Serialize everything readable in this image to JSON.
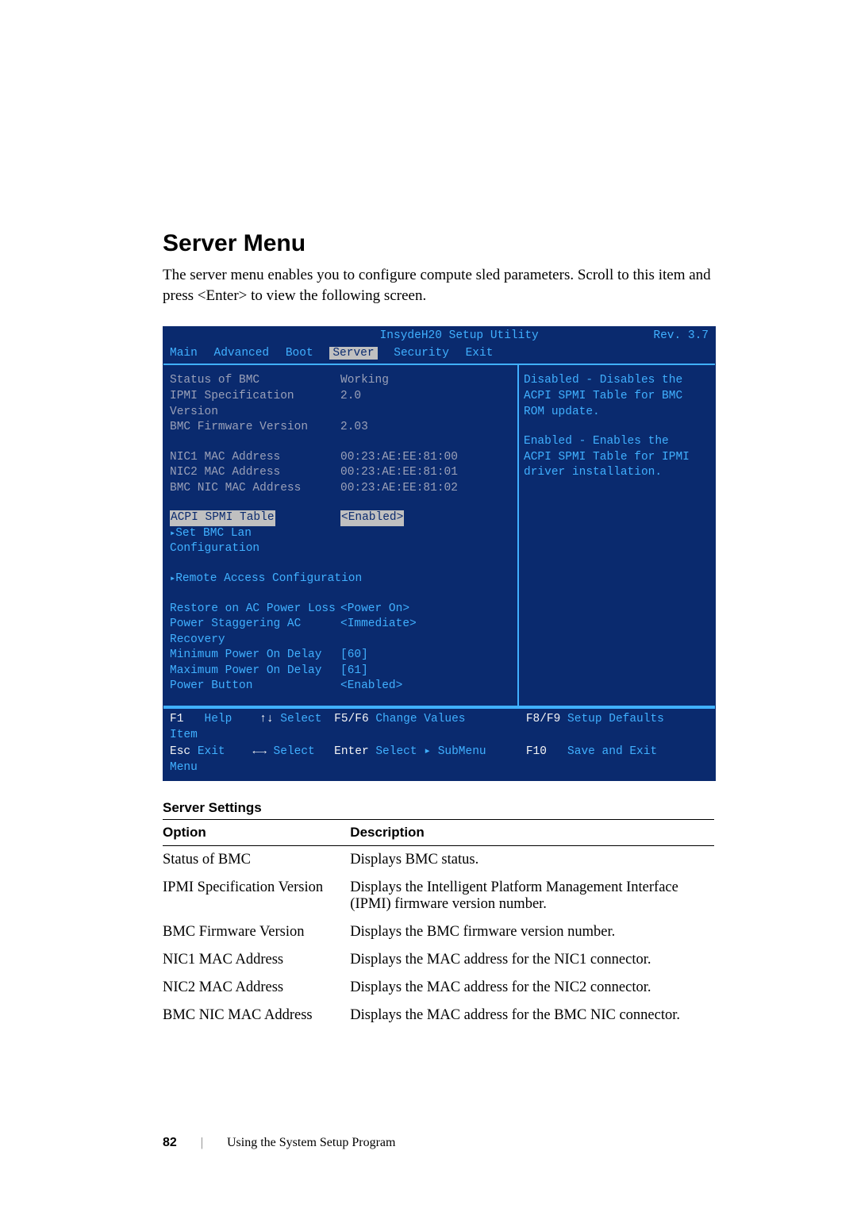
{
  "heading": "Server Menu",
  "intro": "The server menu enables you to configure compute sled parameters. Scroll to this item and press <Enter> to view the following screen.",
  "bios": {
    "title": "InsydeH20 Setup Utility",
    "rev": "Rev. 3.7",
    "menubar": [
      "Main",
      "Advanced",
      "Boot",
      "Server",
      "Security",
      "Exit"
    ],
    "selected_tab": "Server",
    "status_rows": [
      {
        "k": "Status of BMC",
        "v": "Working",
        "muted": true
      },
      {
        "k": "IPMI Specification Version",
        "v": "2.0",
        "muted": true
      },
      {
        "k": "BMC Firmware Version",
        "v": "2.03",
        "muted": true
      }
    ],
    "mac_rows": [
      {
        "k": "NIC1 MAC Address",
        "v": "00:23:AE:EE:81:00",
        "muted": true
      },
      {
        "k": "NIC2 MAC Address",
        "v": "00:23:AE:EE:81:01",
        "muted": true
      },
      {
        "k": "BMC NIC MAC Address",
        "v": "00:23:AE:EE:81:02",
        "muted": true
      }
    ],
    "selected_item": {
      "k": "ACPI SPMI Table",
      "v": "<Enabled>"
    },
    "submenus_a": [
      "Set BMC Lan Configuration"
    ],
    "submenus_b": [
      "Remote Access Configuration"
    ],
    "power_rows": [
      {
        "k": "Restore on AC Power Loss",
        "v": "<Power On>"
      },
      {
        "k": "Power Staggering AC Recovery",
        "v": "<Immediate>"
      },
      {
        "k": "Minimum Power On Delay",
        "v": "[60]"
      },
      {
        "k": "Maximum Power On Delay",
        "v": "[61]"
      },
      {
        "k": "Power Button",
        "v": "<Enabled>"
      }
    ],
    "help_lines": [
      "Disabled - Disables the",
      "ACPI SPMI Table for BMC",
      "ROM update.",
      "",
      "Enabled - Enables the",
      "ACPI SPMI Table for IPMI",
      "driver installation."
    ],
    "footer": [
      {
        "k": "F1",
        "d": "Help"
      },
      {
        "k": "↑↓",
        "d": "Select Item"
      },
      {
        "k": "F5/F6",
        "d": "Change Values"
      },
      {
        "k": "F8/F9",
        "d": "Setup Defaults"
      },
      {
        "k": "Esc",
        "d": "Exit"
      },
      {
        "k": "←→",
        "d": "Select Menu"
      },
      {
        "k": "Enter",
        "d": "Select ▸ SubMenu"
      },
      {
        "k": "F10",
        "d": "Save and Exit"
      }
    ]
  },
  "settings": {
    "title": "Server Settings",
    "headers": {
      "option": "Option",
      "desc": "Description"
    },
    "rows": [
      {
        "option": "Status of BMC",
        "desc": "Displays BMC status."
      },
      {
        "option": "IPMI Specification Version",
        "desc": "Displays the Intelligent Platform Management Interface (IPMI) firmware version number."
      },
      {
        "option": "BMC Firmware Version",
        "desc": "Displays the BMC firmware version number."
      },
      {
        "option": "NIC1 MAC Address",
        "desc": "Displays the MAC address for the NIC1 connector."
      },
      {
        "option": "NIC2 MAC Address",
        "desc": "Displays the MAC address for the NIC2 connector."
      },
      {
        "option": "BMC NIC MAC Address",
        "desc": "Displays the MAC address for the BMC NIC connector."
      }
    ]
  },
  "page_footer": {
    "page_number": "82",
    "separator": "|",
    "section": "Using the System Setup Program"
  }
}
